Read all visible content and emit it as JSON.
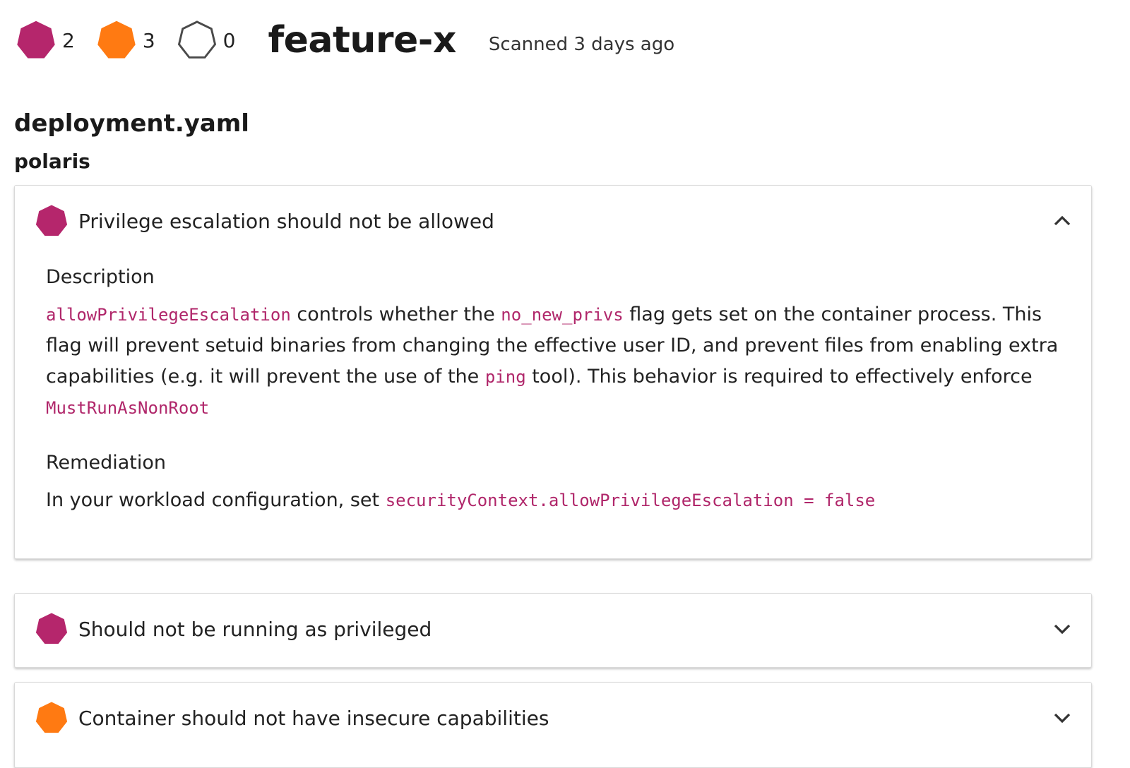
{
  "header": {
    "counts": [
      {
        "severity": "danger",
        "color": "#b5266c",
        "count": "2"
      },
      {
        "severity": "warning",
        "color": "#ff7a12",
        "count": "3"
      },
      {
        "severity": "passing",
        "color": "#ffffff",
        "count": "0"
      }
    ],
    "branch": "feature-x",
    "scanned": "Scanned 3 days ago"
  },
  "file": {
    "name": "deployment.yaml",
    "tool": "polaris"
  },
  "findings": [
    {
      "title": "Privilege escalation should not be allowed",
      "severity_color": "#b5266c",
      "expanded": true,
      "description_label": "Description",
      "description": {
        "code1": "allowPrivilegeEscalation",
        "text1": " controls whether the ",
        "code2": "no_new_privs",
        "text2": " flag gets set on the container process. This flag will prevent setuid binaries from changing the effective user ID, and prevent files from enabling extra capabilities (e.g. it will prevent the use of the ",
        "code3": "ping",
        "text3": " tool). This behavior is required to effectively enforce ",
        "code4": "MustRunAsNonRoot"
      },
      "remediation_label": "Remediation",
      "remediation": {
        "text": "In your workload configuration, set ",
        "code": "securityContext.allowPrivilegeEscalation = false"
      }
    },
    {
      "title": "Should not be running as privileged",
      "severity_color": "#b5266c",
      "expanded": false
    },
    {
      "title": "Container should not have insecure capabilities",
      "severity_color": "#ff7a12",
      "expanded": false
    }
  ],
  "icons": {
    "danger": "heptagon-danger-icon",
    "warning": "heptagon-warning-icon",
    "passing": "heptagon-outline-icon",
    "chevron_up": "chevron-up-icon",
    "chevron_down": "chevron-down-icon"
  }
}
